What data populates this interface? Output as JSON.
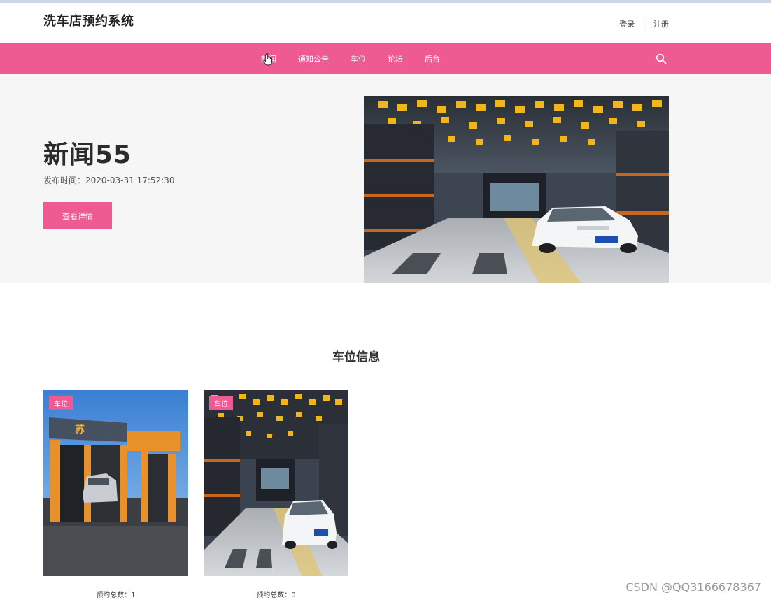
{
  "site": {
    "title": "洗车店预约系统"
  },
  "auth": {
    "login": "登录",
    "separator": "|",
    "register": "注册"
  },
  "nav": {
    "items": [
      {
        "label": "新闻"
      },
      {
        "label": "通知公告"
      },
      {
        "label": "车位"
      },
      {
        "label": "论坛"
      },
      {
        "label": "后台"
      }
    ],
    "search_icon": "search-icon"
  },
  "hero": {
    "title": "新闻55",
    "date": "发布时间：2020-03-31 17:52:30",
    "button": "查看详情"
  },
  "section": {
    "title": "车位信息",
    "cards": [
      {
        "badge": "车位",
        "count": "预约总数：1"
      },
      {
        "badge": "车位",
        "count": "预约总数：0"
      }
    ]
  },
  "watermark": "CSDN @QQ3166678367",
  "colors": {
    "accent": "#ee5a92",
    "hero_bg": "#f7f6f7"
  }
}
